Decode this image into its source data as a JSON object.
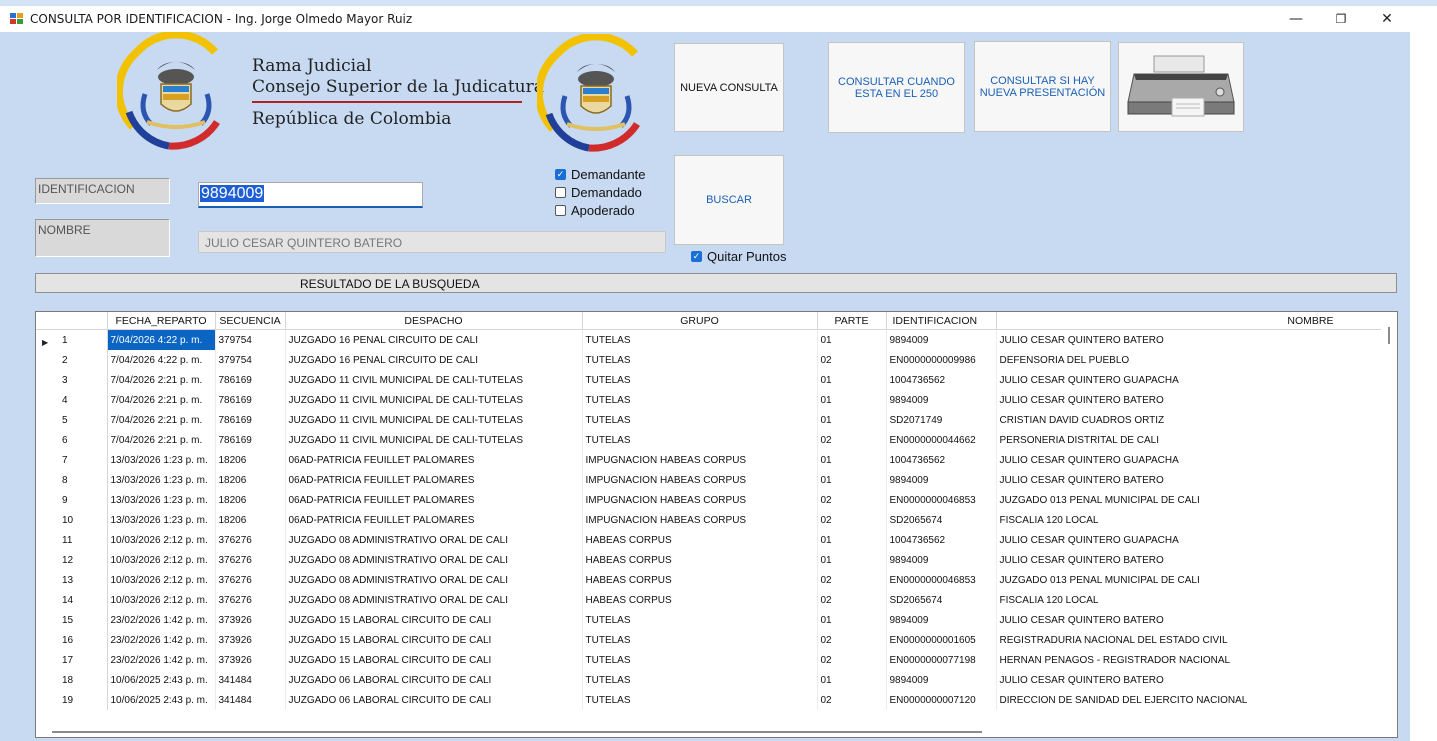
{
  "window": {
    "title": "CONSULTA POR IDENTIFICACION - Ing. Jorge Olmedo Mayor Ruiz",
    "minimize": "—",
    "restore": "❐",
    "close": "✕"
  },
  "header": {
    "line1": "Rama Judicial",
    "line2": "Consejo Superior de la Judicatura",
    "line3": "República de Colombia"
  },
  "buttons": {
    "nueva_consulta": "NUEVA CONSULTA",
    "consultar_250": "CONSULTAR CUANDO ESTA EN EL 250",
    "consultar_presentacion": "CONSULTAR SI HAY NUEVA PRESENTACIÓN",
    "buscar": "BUSCAR",
    "print_icon": "printer-icon"
  },
  "form": {
    "id_label": "IDENTIFICACION",
    "id_value": "9894009",
    "nombre_label": "NOMBRE",
    "nombre_value": "JULIO CESAR QUINTERO BATERO",
    "checkboxes": [
      {
        "label": "Demandante",
        "checked": true
      },
      {
        "label": "Demandado",
        "checked": false
      },
      {
        "label": "Apoderado",
        "checked": false
      }
    ],
    "quitar_puntos": {
      "label": "Quitar Puntos",
      "checked": true
    }
  },
  "result_title": "RESULTADO DE LA BUSQUEDA",
  "grid": {
    "columns": [
      "FECHA_REPARTO",
      "SECUENCIA",
      "DESPACHO",
      "GRUPO",
      "PARTE",
      "IDENTIFICACION",
      "NOMBRE"
    ],
    "current_row_marker": "▶",
    "rows": [
      {
        "n": "1",
        "fecha": "7/04/2026 4:22 p. m.",
        "sec": "379754",
        "despacho": "JUZGADO 16 PENAL CIRCUITO DE CALI",
        "grupo": "TUTELAS",
        "parte": "01",
        "ident": "9894009",
        "nombre": "JULIO CESAR QUINTERO BATERO"
      },
      {
        "n": "2",
        "fecha": "7/04/2026 4:22 p. m.",
        "sec": "379754",
        "despacho": "JUZGADO 16 PENAL CIRCUITO DE CALI",
        "grupo": "TUTELAS",
        "parte": "02",
        "ident": "EN0000000009986",
        "nombre": "DEFENSORIA DEL PUEBLO"
      },
      {
        "n": "3",
        "fecha": "7/04/2026 2:21 p. m.",
        "sec": "786169",
        "despacho": "JUZGADO 11 CIVIL MUNICIPAL DE CALI-TUTELAS",
        "grupo": "TUTELAS",
        "parte": "01",
        "ident": "1004736562",
        "nombre": "JULIO CESAR QUINTERO GUAPACHA"
      },
      {
        "n": "4",
        "fecha": "7/04/2026 2:21 p. m.",
        "sec": "786169",
        "despacho": "JUZGADO 11 CIVIL MUNICIPAL DE CALI-TUTELAS",
        "grupo": "TUTELAS",
        "parte": "01",
        "ident": "9894009",
        "nombre": "JULIO CESAR QUINTERO BATERO"
      },
      {
        "n": "5",
        "fecha": "7/04/2026 2:21 p. m.",
        "sec": "786169",
        "despacho": "JUZGADO 11 CIVIL MUNICIPAL DE CALI-TUTELAS",
        "grupo": "TUTELAS",
        "parte": "01",
        "ident": "SD2071749",
        "nombre": "CRISTIAN DAVID CUADROS ORTIZ"
      },
      {
        "n": "6",
        "fecha": "7/04/2026 2:21 p. m.",
        "sec": "786169",
        "despacho": "JUZGADO 11 CIVIL MUNICIPAL DE CALI-TUTELAS",
        "grupo": "TUTELAS",
        "parte": "02",
        "ident": "EN0000000044662",
        "nombre": "PERSONERIA DISTRITAL DE CALI"
      },
      {
        "n": "7",
        "fecha": "13/03/2026 1:23 p. m.",
        "sec": "18206",
        "despacho": "06AD-PATRICIA FEUILLET PALOMARES",
        "grupo": "IMPUGNACION HABEAS CORPUS",
        "parte": "01",
        "ident": "1004736562",
        "nombre": "JULIO CESAR QUINTERO GUAPACHA"
      },
      {
        "n": "8",
        "fecha": "13/03/2026 1:23 p. m.",
        "sec": "18206",
        "despacho": "06AD-PATRICIA FEUILLET PALOMARES",
        "grupo": "IMPUGNACION HABEAS CORPUS",
        "parte": "01",
        "ident": "9894009",
        "nombre": "JULIO CESAR QUINTERO BATERO"
      },
      {
        "n": "9",
        "fecha": "13/03/2026 1:23 p. m.",
        "sec": "18206",
        "despacho": "06AD-PATRICIA FEUILLET PALOMARES",
        "grupo": "IMPUGNACION HABEAS CORPUS",
        "parte": "02",
        "ident": "EN0000000046853",
        "nombre": "JUZGADO 013 PENAL MUNICIPAL DE CALI"
      },
      {
        "n": "10",
        "fecha": "13/03/2026 1:23 p. m.",
        "sec": "18206",
        "despacho": "06AD-PATRICIA FEUILLET PALOMARES",
        "grupo": "IMPUGNACION HABEAS CORPUS",
        "parte": "02",
        "ident": "SD2065674",
        "nombre": "FISCALIA 120 LOCAL"
      },
      {
        "n": "11",
        "fecha": "10/03/2026 2:12 p. m.",
        "sec": "376276",
        "despacho": "JUZGADO 08 ADMINISTRATIVO ORAL DE CALI",
        "grupo": "HABEAS CORPUS",
        "parte": "01",
        "ident": "1004736562",
        "nombre": "JULIO CESAR QUINTERO GUAPACHA"
      },
      {
        "n": "12",
        "fecha": "10/03/2026 2:12 p. m.",
        "sec": "376276",
        "despacho": "JUZGADO 08 ADMINISTRATIVO ORAL DE CALI",
        "grupo": "HABEAS CORPUS",
        "parte": "01",
        "ident": "9894009",
        "nombre": "JULIO CESAR QUINTERO BATERO"
      },
      {
        "n": "13",
        "fecha": "10/03/2026 2:12 p. m.",
        "sec": "376276",
        "despacho": "JUZGADO 08 ADMINISTRATIVO ORAL DE CALI",
        "grupo": "HABEAS CORPUS",
        "parte": "02",
        "ident": "EN0000000046853",
        "nombre": "JUZGADO 013 PENAL MUNICIPAL DE CALI"
      },
      {
        "n": "14",
        "fecha": "10/03/2026 2:12 p. m.",
        "sec": "376276",
        "despacho": "JUZGADO 08 ADMINISTRATIVO ORAL DE CALI",
        "grupo": "HABEAS CORPUS",
        "parte": "02",
        "ident": "SD2065674",
        "nombre": "FISCALIA 120 LOCAL"
      },
      {
        "n": "15",
        "fecha": "23/02/2026 1:42 p. m.",
        "sec": "373926",
        "despacho": "JUZGADO 15 LABORAL CIRCUITO DE CALI",
        "grupo": "TUTELAS",
        "parte": "01",
        "ident": "9894009",
        "nombre": "JULIO CESAR QUINTERO BATERO"
      },
      {
        "n": "16",
        "fecha": "23/02/2026 1:42 p. m.",
        "sec": "373926",
        "despacho": "JUZGADO 15 LABORAL CIRCUITO DE CALI",
        "grupo": "TUTELAS",
        "parte": "02",
        "ident": "EN0000000001605",
        "nombre": "REGISTRADURIA NACIONAL DEL ESTADO CIVIL"
      },
      {
        "n": "17",
        "fecha": "23/02/2026 1:42 p. m.",
        "sec": "373926",
        "despacho": "JUZGADO 15 LABORAL CIRCUITO DE CALI",
        "grupo": "TUTELAS",
        "parte": "02",
        "ident": "EN0000000077198",
        "nombre": "HERNAN PENAGOS - REGISTRADOR NACIONAL"
      },
      {
        "n": "18",
        "fecha": "10/06/2025 2:43 p. m.",
        "sec": "341484",
        "despacho": "JUZGADO 06 LABORAL CIRCUITO DE CALI",
        "grupo": "TUTELAS",
        "parte": "01",
        "ident": "9894009",
        "nombre": "JULIO CESAR QUINTERO BATERO"
      },
      {
        "n": "19",
        "fecha": "10/06/2025 2:43 p. m.",
        "sec": "341484",
        "despacho": "JUZGADO 06 LABORAL CIRCUITO DE CALI",
        "grupo": "TUTELAS",
        "parte": "02",
        "ident": "EN0000000007120",
        "nombre": "DIRECCION DE SANIDAD DEL EJERCITO NACIONAL"
      }
    ]
  }
}
